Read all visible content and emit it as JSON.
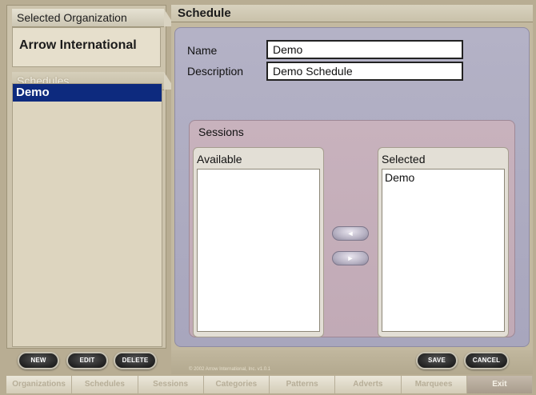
{
  "left_panel": {
    "org_tab_label": "Selected Organization",
    "org_name": "Arrow International",
    "schedules_tab_label": "Schedules",
    "schedules": [
      {
        "label": "Demo",
        "selected": true
      }
    ],
    "buttons": {
      "new": "NEW",
      "edit": "EDIT",
      "delete": "DELETE"
    }
  },
  "main": {
    "title": "Schedule",
    "name_label": "Name",
    "name_value": "Demo",
    "description_label": "Description",
    "description_value": "Demo Schedule",
    "sessions": {
      "title": "Sessions",
      "available_label": "Available",
      "available_items": [],
      "selected_label": "Selected",
      "selected_items": [
        "Demo"
      ],
      "move_left_glyph": "◄",
      "move_right_glyph": "►"
    },
    "save_label": "SAVE",
    "cancel_label": "CANCEL",
    "copyright": "© 2002 Arrow International, Inc. v1.0.1"
  },
  "nav": {
    "tabs": [
      "Organizations",
      "Schedules",
      "Sessions",
      "Categories",
      "Patterns",
      "Adverts",
      "Marquees",
      "Exit"
    ]
  },
  "colors": {
    "selection": "#0d2a7e",
    "frame": "#b4b2c6",
    "sessions_frame": "#c8b2bd",
    "panel": "#ccc3ac"
  }
}
